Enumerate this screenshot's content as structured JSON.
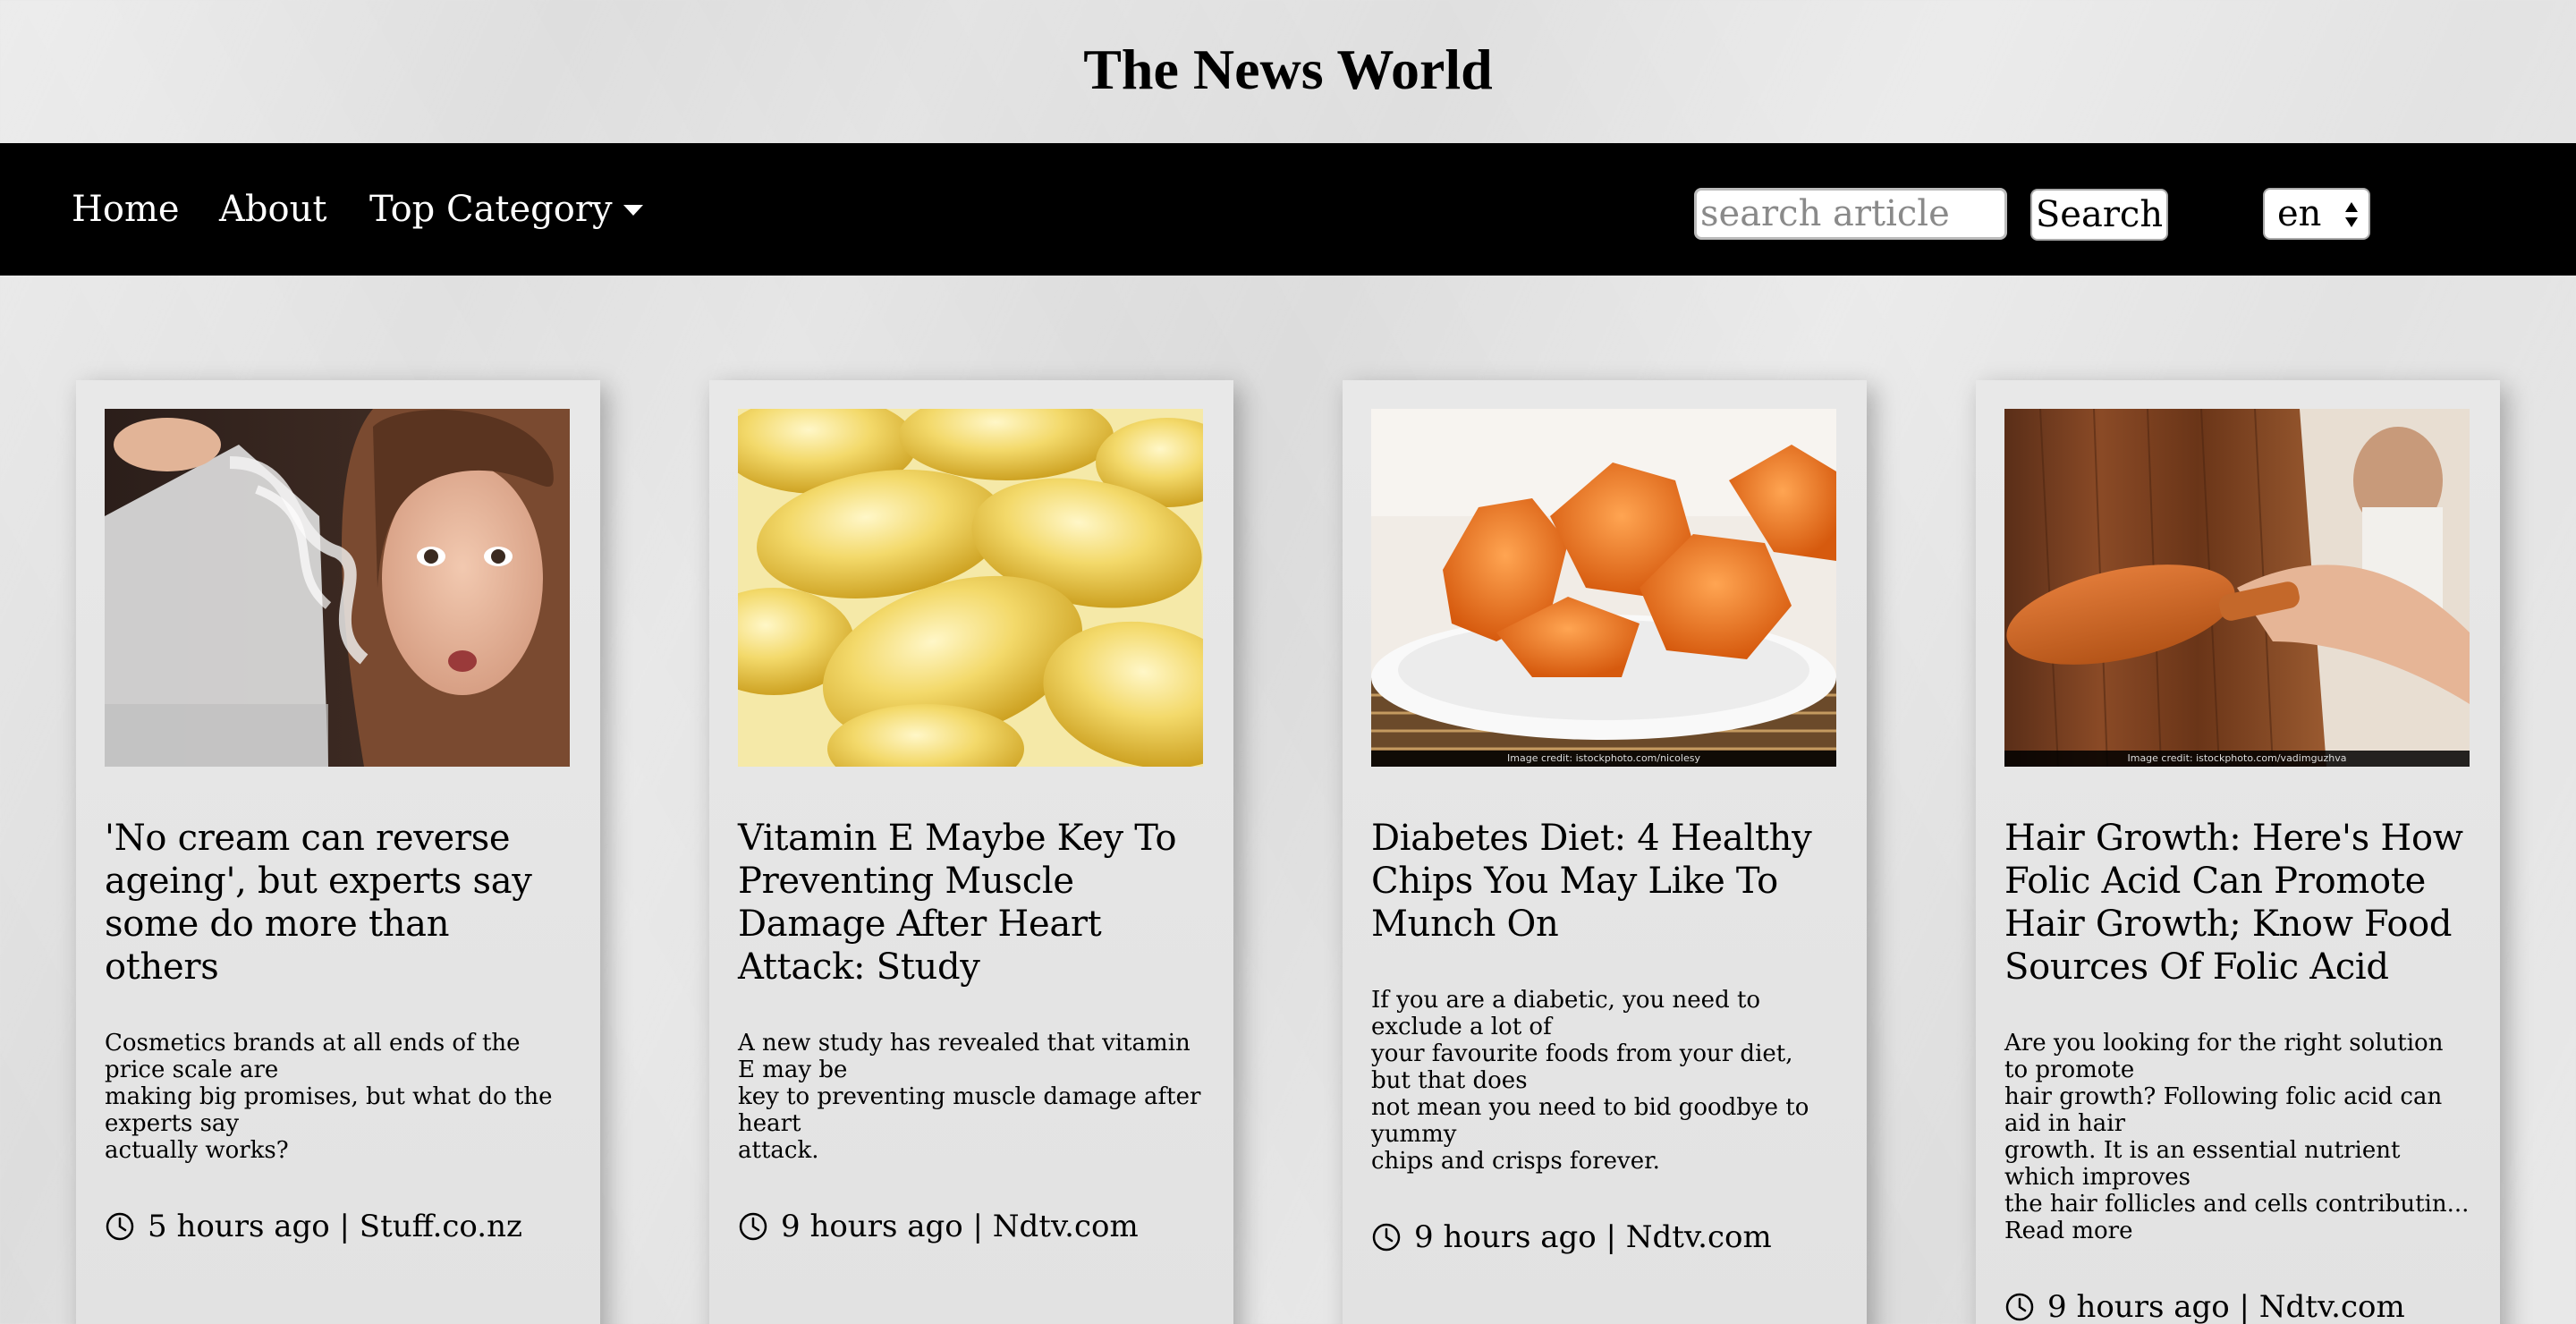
{
  "site": {
    "title": "The News World"
  },
  "nav": {
    "home": "Home",
    "about": "About",
    "top_category": "Top Category",
    "search_placeholder": "search article",
    "search_button": "Search",
    "language": "en"
  },
  "articles": [
    {
      "title": "'No cream can reverse ageing', but experts say some do more than others",
      "desc_lines": [
        "Cosmetics brands at all ends of the price scale are",
        "making big promises, but what do the experts say",
        "actually works?"
      ],
      "meta": "5 hours ago | Stuff.co.nz",
      "image_credit": "",
      "read_more": ""
    },
    {
      "title": "Vitamin E Maybe Key To Preventing Muscle Damage After Heart Attack: Study",
      "desc_lines": [
        "A new study has revealed that vitamin E may be",
        "key to preventing muscle damage after heart",
        "attack."
      ],
      "meta": "9 hours ago | Ndtv.com",
      "image_credit": "",
      "read_more": ""
    },
    {
      "title": "Diabetes Diet: 4 Healthy Chips You May Like To Munch On",
      "desc_lines": [
        "If you are a diabetic, you need to exclude a lot of",
        "your favourite foods from your diet, but that does",
        "not mean you need to bid goodbye to yummy",
        "chips and crisps forever."
      ],
      "meta": "9 hours ago | Ndtv.com",
      "image_credit": "Image credit: istockphoto.com/nicolesy",
      "read_more": ""
    },
    {
      "title": "Hair Growth: Here's How Folic Acid Can Promote Hair Growth; Know Food Sources Of Folic Acid",
      "desc_lines": [
        "Are you looking for the right solution to promote",
        "hair growth? Following folic acid can aid in hair",
        "growth. It is an essential nutrient which improves",
        "the hair follicles and cells contributin..."
      ],
      "meta": "9 hours ago | Ndtv.com",
      "image_credit": "Image credit: istockphoto.com/vadimguzhva",
      "read_more": "Read more"
    }
  ],
  "colors": {
    "navbar": "#000000",
    "page_bg": "#e3e3e3",
    "card_bg": "#e6e6e6"
  },
  "icons": {
    "clock": "clock-icon",
    "dropdown": "caret-down-icon"
  }
}
